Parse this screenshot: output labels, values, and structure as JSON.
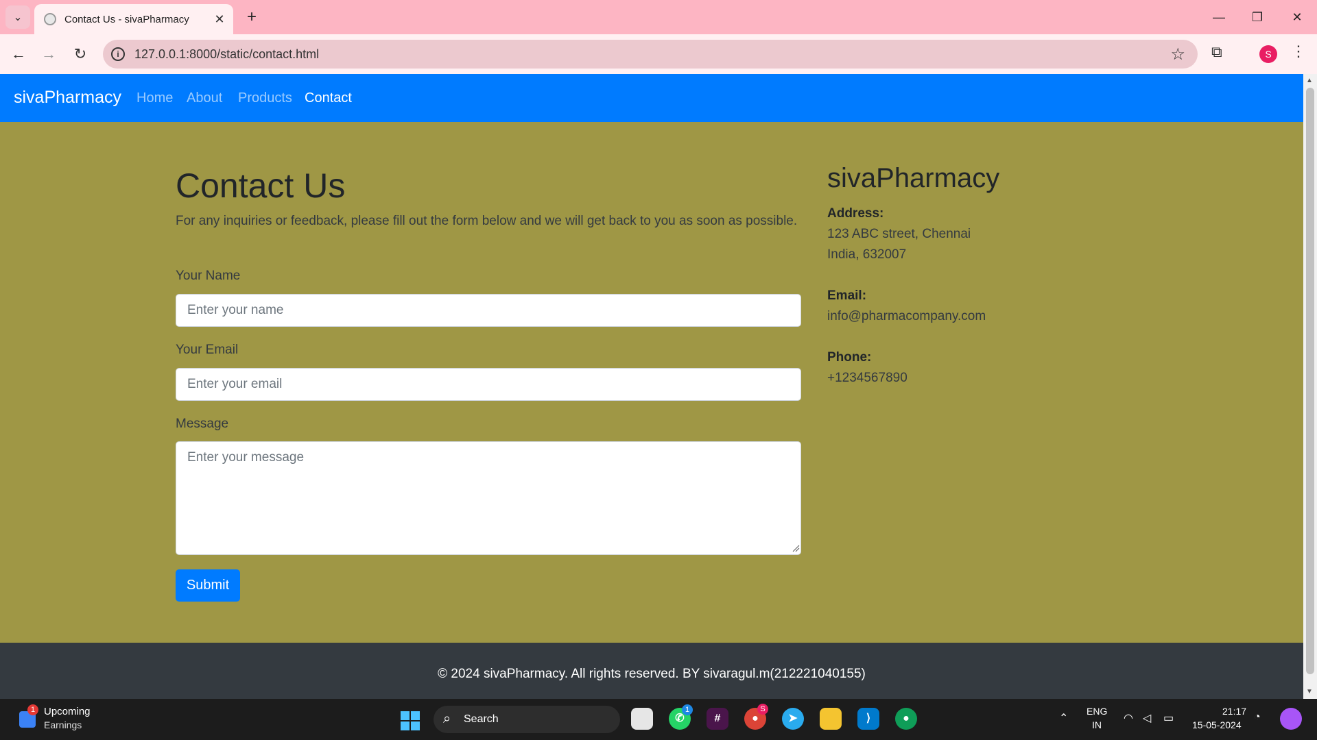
{
  "browser": {
    "tab_title": "Contact Us - sivaPharmacy",
    "url": "127.0.0.1:8000/static/contact.html",
    "profile_initial": "S"
  },
  "site": {
    "brand": "sivaPharmacy",
    "nav": [
      {
        "label": "Home",
        "active": false
      },
      {
        "label": "About",
        "active": false
      },
      {
        "label": "Products",
        "active": false
      },
      {
        "label": "Contact",
        "active": true
      }
    ],
    "colors": {
      "navbar": "#007bff",
      "page_bg": "#9f9745",
      "footer": "#343a40",
      "button": "#007bff"
    }
  },
  "contact_form": {
    "title": "Contact Us",
    "intro": "For any inquiries or feedback, please fill out the form below and we will get back to you as soon as possible.",
    "name_label": "Your Name",
    "name_placeholder": "Enter your name",
    "email_label": "Your Email",
    "email_placeholder": "Enter your email",
    "message_label": "Message",
    "message_placeholder": "Enter your message",
    "submit_label": "Submit"
  },
  "sidebar": {
    "brand": "sivaPharmacy",
    "address_label": "Address:",
    "address_line1": "123 ABC street, Chennai",
    "address_line2": "India, 632007",
    "email_label": "Email:",
    "email_value": "info@pharmacompany.com",
    "phone_label": "Phone:",
    "phone_value": "+1234567890"
  },
  "footer": {
    "text": "© 2024 sivaPharmacy. All rights reserved. BY sivaragul.m(212221040155)"
  },
  "taskbar": {
    "widget_title": "Upcoming",
    "widget_subtitle": "Earnings",
    "widget_badge": "1",
    "search_text": "Search",
    "whatsapp_badge": "1",
    "chrome_badge": "S",
    "lang_line1": "ENG",
    "lang_line2": "IN",
    "time": "21:17",
    "date": "15-05-2024"
  }
}
